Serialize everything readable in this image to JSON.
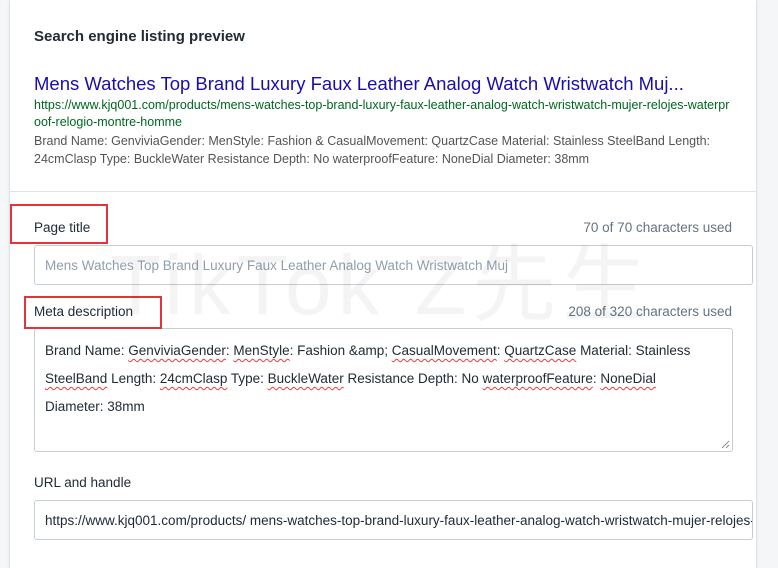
{
  "seo": {
    "section_title": "Search engine listing preview",
    "preview": {
      "title": "Mens Watches Top Brand Luxury Faux Leather Analog Watch Wristwatch Muj...",
      "url": "https://www.kjq001.com/products/mens-watches-top-brand-luxury-faux-leather-analog-watch-wristwatch-mujer-relojes-waterproof-relogio-montre-homme",
      "description": "Brand Name: GenviviaGender: MenStyle: Fashion & CasualMovement: QuartzCase Material: Stainless SteelBand Length: 24cmClasp Type: BuckleWater Resistance Depth: No waterproofFeature: NoneDial Diameter: 38mm"
    },
    "page_title": {
      "label": "Page title",
      "count": "70 of 70 characters used",
      "placeholder": "Mens Watches Top Brand Luxury Faux Leather Analog Watch Wristwatch Muj"
    },
    "meta_description": {
      "label": "Meta description",
      "count": "208 of 320 characters used",
      "segments": [
        "Brand Name: ",
        "GenviviaGender",
        ": ",
        "MenStyle",
        ": Fashion &amp; ",
        "CasualMovement",
        ": ",
        "QuartzCase",
        " Material: Stainless ",
        "SteelBand",
        " Length: ",
        "24cmClasp",
        " Type: ",
        "BuckleWater",
        " Resistance Depth: No ",
        "waterproofFeature",
        ": ",
        "NoneDial",
        " Diameter: 38mm"
      ]
    },
    "url_handle": {
      "label": "URL and handle",
      "prefix": "https://www.kjq001.com/products/",
      "handle": "mens-watches-top-brand-luxury-faux-leather-analog-watch-wristwatch-mujer-relojes-waterproof-relogio-montre-homme"
    }
  },
  "watermark": "TikTok Z先生",
  "colors": {
    "link_title": "#1a0dab",
    "link_url": "#006621",
    "highlight": "#e0353d",
    "spellcheck": "#e2403a"
  }
}
